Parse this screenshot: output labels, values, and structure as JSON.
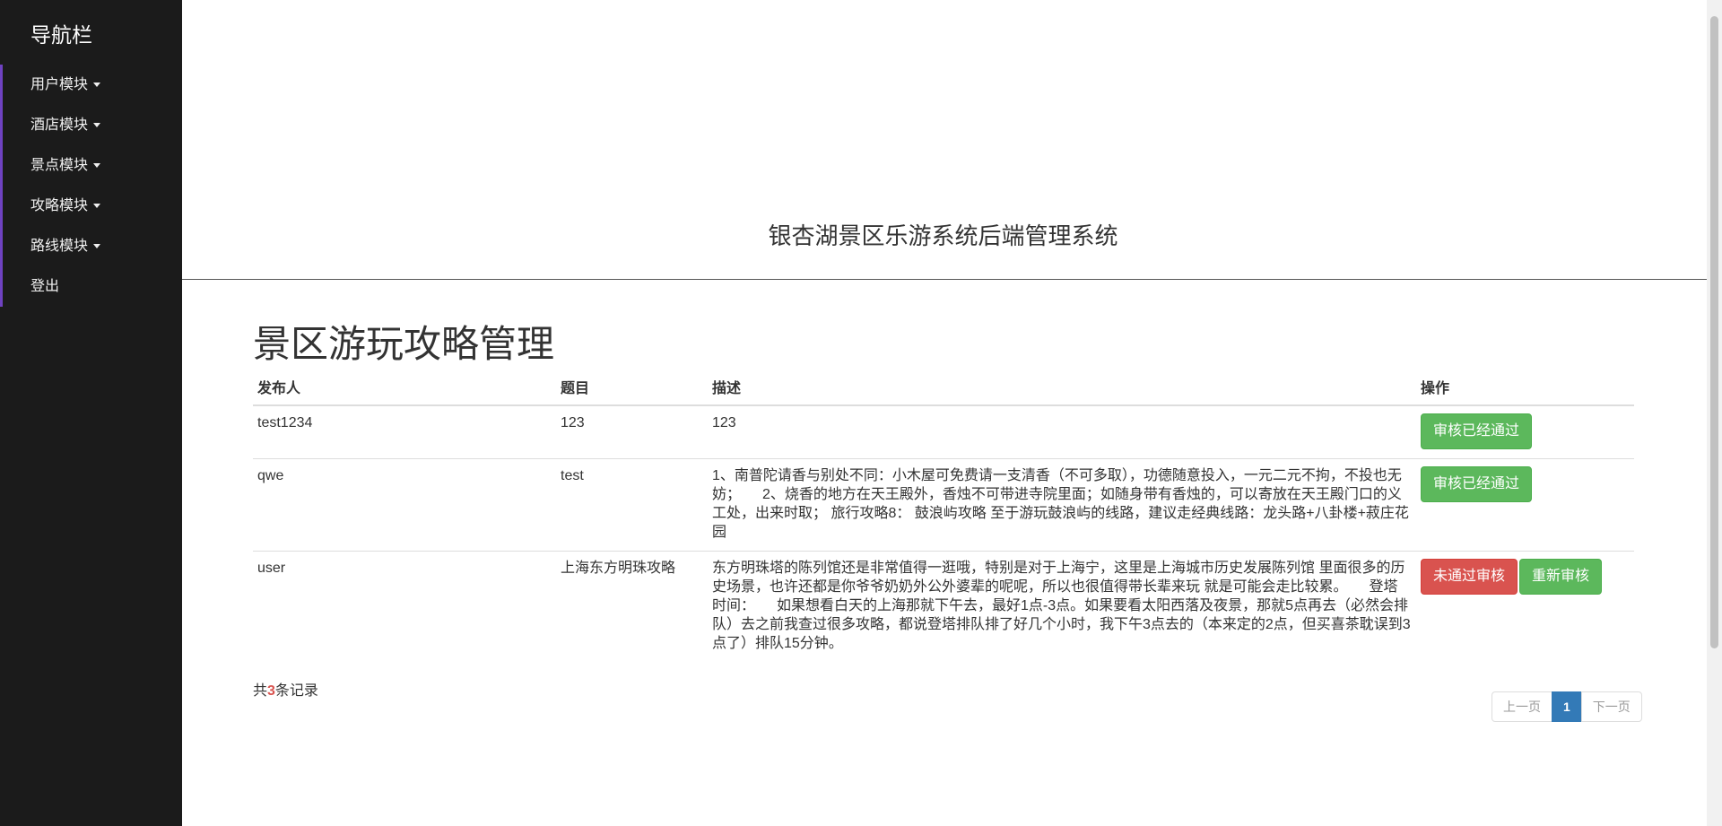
{
  "sidebar": {
    "brand": "导航栏",
    "items": [
      {
        "label": "用户模块",
        "dropdown": true
      },
      {
        "label": "酒店模块",
        "dropdown": true
      },
      {
        "label": "景点模块",
        "dropdown": true
      },
      {
        "label": "攻略模块",
        "dropdown": true
      },
      {
        "label": "路线模块",
        "dropdown": true
      },
      {
        "label": "登出",
        "dropdown": false
      }
    ]
  },
  "header": {
    "title": "银杏湖景区乐游系统后端管理系统"
  },
  "main": {
    "page_title": "景区游玩攻略管理",
    "columns": [
      "发布人",
      "题目",
      "描述",
      "操作"
    ],
    "rows": [
      {
        "publisher": "test1234",
        "topic": "123",
        "description": "123",
        "actions": [
          {
            "label": "审核已经通过",
            "style": "success"
          }
        ]
      },
      {
        "publisher": "qwe",
        "topic": "test",
        "description": "1、南普陀请香与别处不同：小木屋可免费请一支清香（不可多取），功德随意投入，一元二元不拘，不投也无妨；　　2、烧香的地方在天王殿外，香烛不可带进寺院里面；如随身带有香烛的，可以寄放在天王殿门口的义工处，出来时取；  旅行攻略8： 鼓浪屿攻略 至于游玩鼓浪屿的线路，建议走经典线路：龙头路+八卦楼+菽庄花园",
        "actions": [
          {
            "label": "审核已经通过",
            "style": "success"
          }
        ]
      },
      {
        "publisher": "user",
        "topic": "上海东方明珠攻略",
        "description": "东方明珠塔的陈列馆还是非常值得一逛哦，特别是对于上海宁，这里是上海城市历史发展陈列馆 里面很多的历史场景，也许还都是你爷爷奶奶外公外婆辈的呢呢，所以也很值得带长辈来玩 就是可能会走比较累。　　登塔时间：　　如果想看白天的上海那就下午去，最好1点-3点。如果要看太阳西落及夜景，那就5点再去（必然会排队）去之前我查过很多攻略，都说登塔排队排了好几个小时，我下午3点去的（本来定的2点，但买喜茶耽误到3点了）排队15分钟。",
        "actions": [
          {
            "label": "未通过审核",
            "style": "danger"
          },
          {
            "label": "重新审核",
            "style": "success"
          }
        ]
      }
    ],
    "record_prefix": "共",
    "record_count": "3",
    "record_suffix": "条记录",
    "pagination": {
      "prev": "上一页",
      "current": "1",
      "next": "下一页"
    }
  },
  "colors": {
    "sidebar_bg": "#1b1b1b",
    "sidebar_accent": "#6f42c1",
    "success": "#5cb85c",
    "danger": "#d9534f",
    "primary": "#337ab7"
  }
}
